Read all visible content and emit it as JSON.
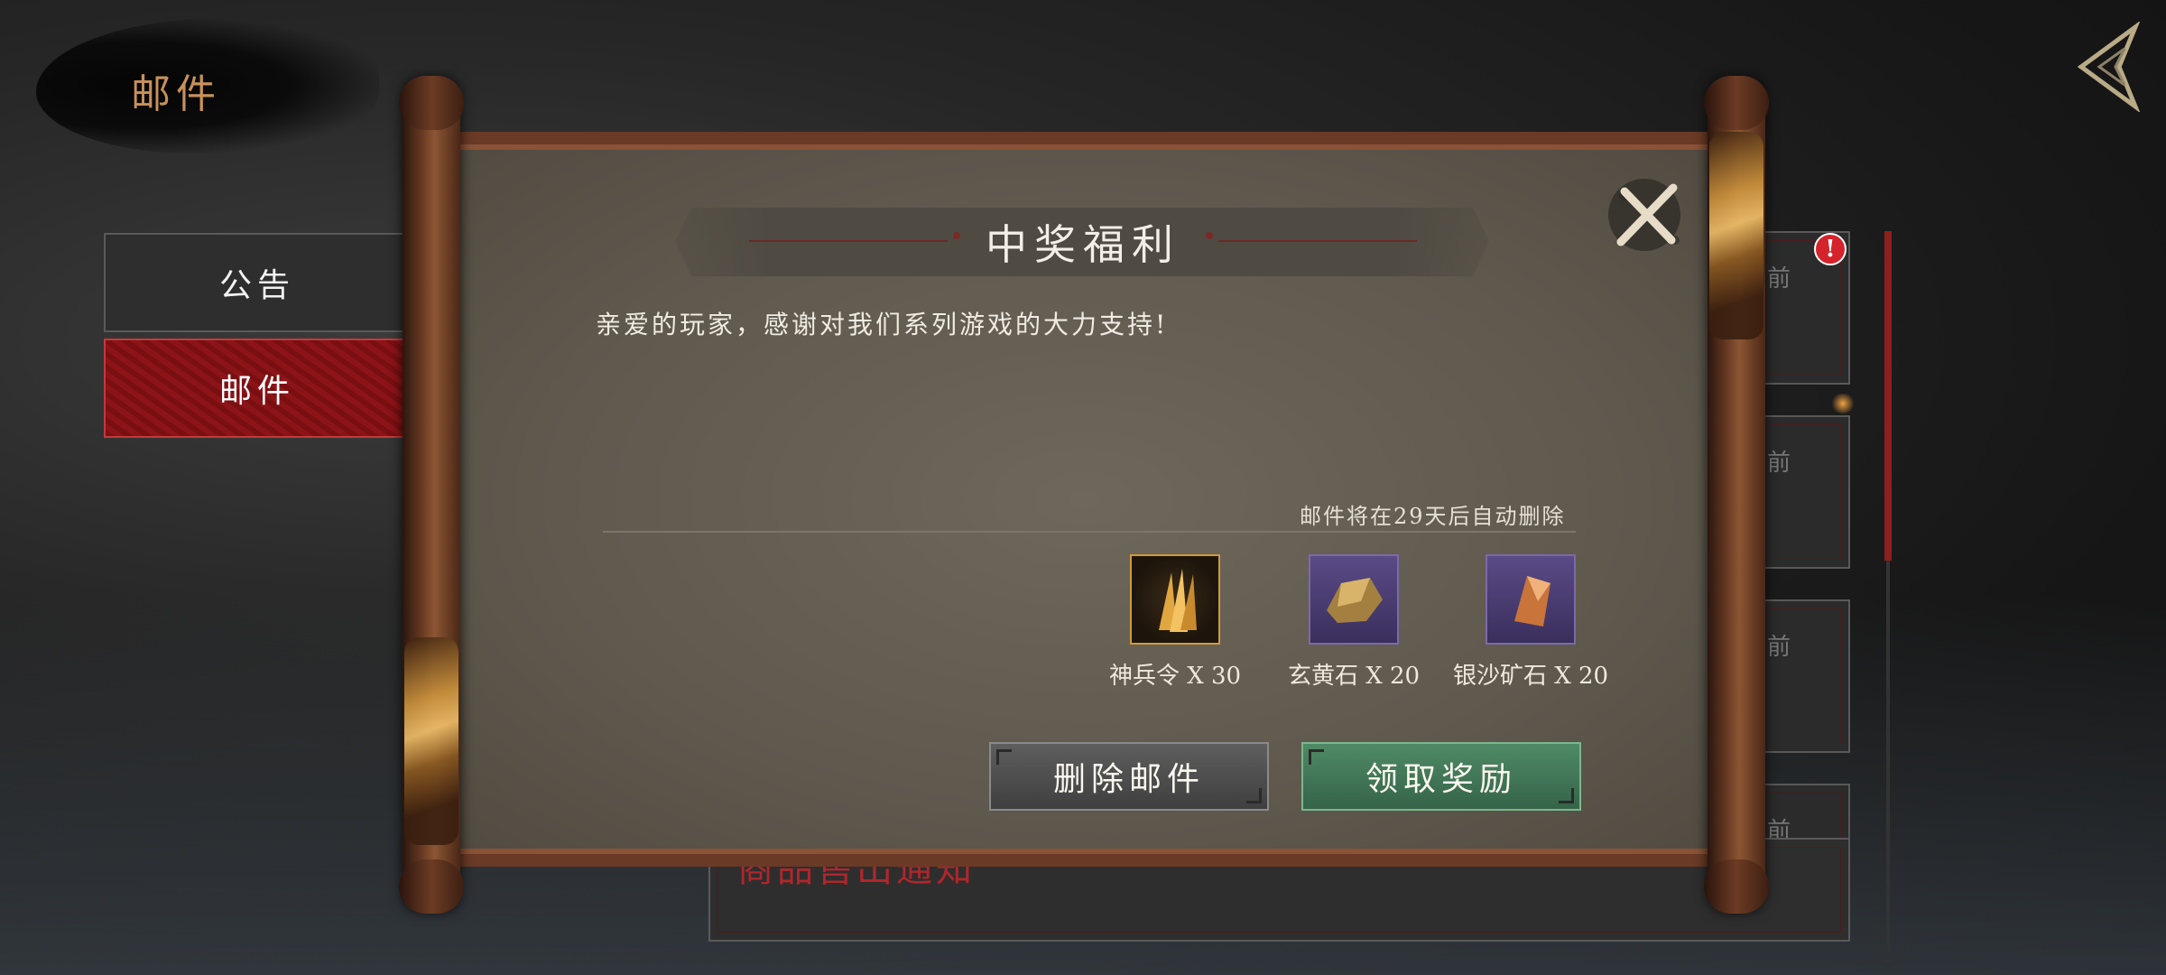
{
  "header": {
    "title": "邮件"
  },
  "nav": {
    "items": [
      {
        "label": "公告"
      },
      {
        "label": "邮件"
      }
    ]
  },
  "mail_list": {
    "visible_card_text": "商品售出通知",
    "card_stub": "前",
    "alert_badge": "!"
  },
  "dialog": {
    "title": "中奖福利",
    "message": "亲爱的玩家，感谢对我们系列游戏的大力支持!",
    "expire_notice": "邮件将在29天后自动删除",
    "rewards": [
      {
        "name": "神兵令 X 30",
        "icon": "spear-token-icon"
      },
      {
        "name": "玄黄石 X 20",
        "icon": "gold-ore-icon"
      },
      {
        "name": "银沙矿石 X 20",
        "icon": "amber-crystal-icon"
      }
    ],
    "buttons": {
      "delete": "删除邮件",
      "claim": "领取奖励"
    }
  },
  "colors": {
    "accent_red": "#8c1418",
    "claim_green": "#4f8a66",
    "title_gold": "#c8915a"
  }
}
